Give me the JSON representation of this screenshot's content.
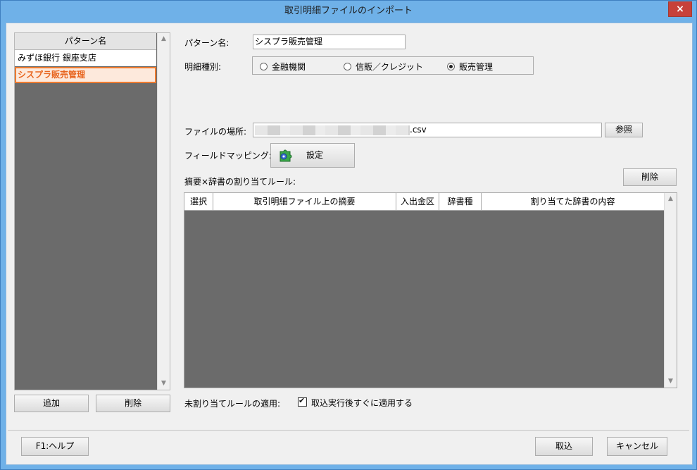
{
  "window": {
    "title": "取引明細ファイルのインポート",
    "close_label": "×"
  },
  "pattern_list": {
    "header": "パターン名",
    "items": [
      {
        "label": "みずほ銀行  銀座支店",
        "selected": false
      },
      {
        "label": "シスプラ販売管理",
        "selected": true
      }
    ],
    "add_label": "追加",
    "delete_label": "削除"
  },
  "form": {
    "pattern_name_label": "パターン名:",
    "pattern_name_value": "シスプラ販売管理",
    "statement_type_label": "明細種別:",
    "statement_types": [
      {
        "label": "金融機関",
        "checked": false
      },
      {
        "label": "信販／クレジット",
        "checked": false
      },
      {
        "label": "販売管理",
        "checked": true
      }
    ],
    "file_location_label": "ファイルの場所:",
    "file_location_value_suffix": ".csv",
    "browse_label": "参照",
    "field_mapping_label": "フィールドマッピング:",
    "settings_label": "設定",
    "rules_label": "摘要×辞書の割り当てルール:",
    "rules_delete_label": "削除"
  },
  "rules_table": {
    "columns": [
      "選択",
      "取引明細ファイル上の摘要",
      "入出金区",
      "辞書種",
      "割り当てた辞書の内容"
    ],
    "rows": []
  },
  "unassigned": {
    "label": "未割り当てルールの適用:",
    "checkbox_label": "取込実行後すぐに適用する",
    "checked": true
  },
  "footer": {
    "help_label": "F1:ヘルプ",
    "import_label": "取込",
    "cancel_label": "キャンセル"
  },
  "colors": {
    "selection_border": "#ec7a2f",
    "selection_text": "#e8651f",
    "panel_background": "#6b6b6b",
    "title_bar": "#6fb1e8",
    "close_button": "#c7413a"
  }
}
